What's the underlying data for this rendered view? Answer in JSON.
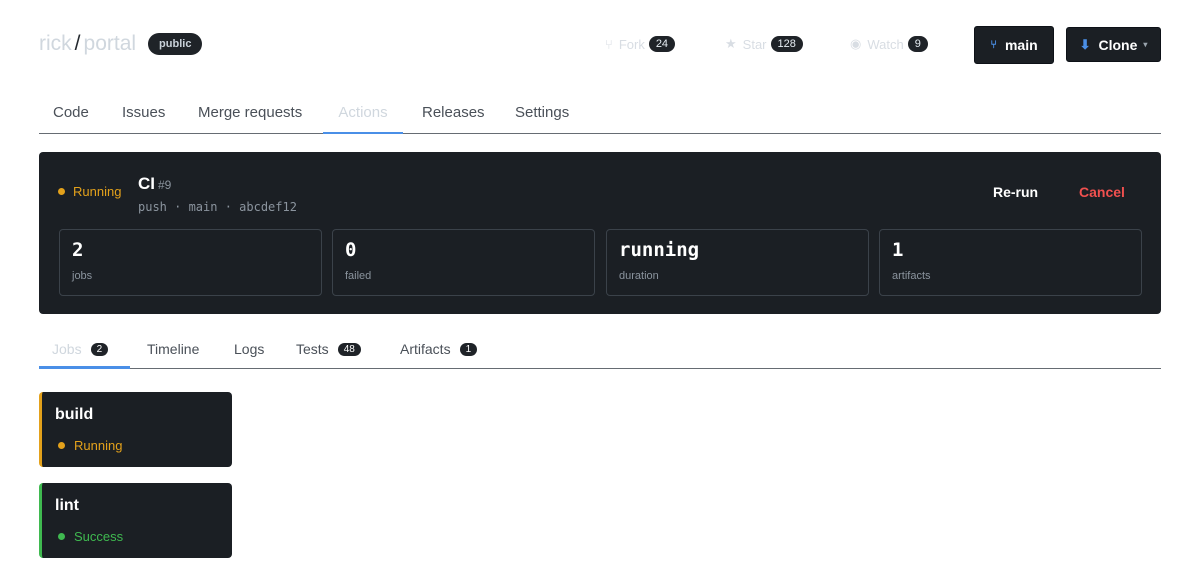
{
  "repo": {
    "owner": "rick",
    "separator": "/",
    "name": "portal",
    "visibility": "public"
  },
  "header": {
    "fork": {
      "icon": "fork-icon",
      "label": "Fork",
      "count": "24"
    },
    "star": {
      "icon": "star-icon",
      "label": "Star",
      "count": "128"
    },
    "watch": {
      "icon": "eye-icon",
      "label": "Watch",
      "count": "9"
    },
    "branch_button": {
      "icon": "branch-icon",
      "label": "main"
    },
    "clone_button": {
      "icon": "download-icon",
      "label": "Clone"
    }
  },
  "tabs": [
    "Code",
    "Issues",
    "Merge requests",
    "Actions",
    "Releases",
    "Settings"
  ],
  "active_tab": "Actions",
  "run": {
    "status": "Running",
    "title": "CI",
    "number": "#9",
    "meta": "push · main · abcdef12",
    "rerun_label": "Re-run",
    "cancel_label": "Cancel",
    "stats": [
      {
        "value": "2",
        "label": "jobs"
      },
      {
        "value": "0",
        "label": "failed"
      },
      {
        "value": "running",
        "label": "duration"
      },
      {
        "value": "1",
        "label": "artifacts"
      }
    ]
  },
  "subtabs": [
    {
      "label": "Jobs",
      "count": "2"
    },
    {
      "label": "Timeline"
    },
    {
      "label": "Logs"
    },
    {
      "label": "Tests",
      "count": "48"
    },
    {
      "label": "Artifacts",
      "count": "1"
    }
  ],
  "jobs": [
    {
      "name": "build",
      "status": "Running",
      "color": "#e3a11b"
    },
    {
      "name": "lint",
      "status": "Success",
      "color": "#3fb950"
    }
  ],
  "colors": {
    "running": "#e3a11b",
    "success": "#3fb950",
    "cancel": "#f0504f",
    "accent": "#4a8fe7"
  }
}
